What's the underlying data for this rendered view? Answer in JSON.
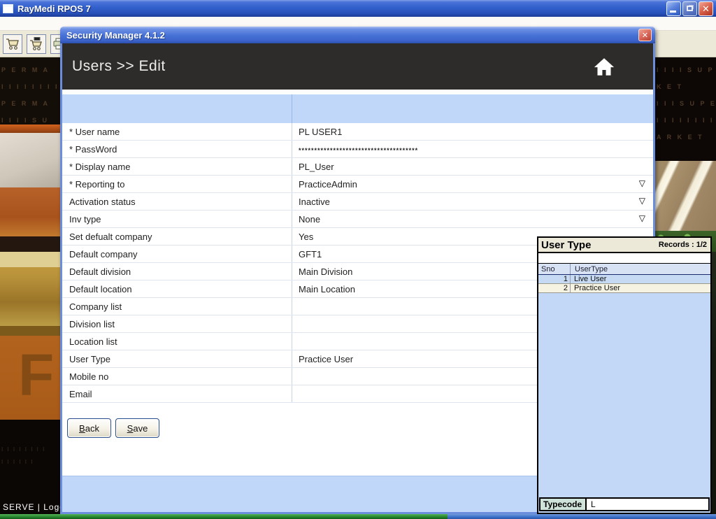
{
  "window": {
    "title": "RayMedi RPOS 7"
  },
  "icons": {
    "dropdown_glyph": "▽",
    "close_glyph": "✕",
    "toolbar": [
      "cart-icon",
      "cart-card-icon",
      "printer-icon"
    ]
  },
  "dialog": {
    "title": "Security Manager 4.1.2",
    "header": "Users >> Edit",
    "form": {
      "rows": [
        {
          "label": "* User name",
          "value": "PL USER1",
          "dropdown": false,
          "masked": false
        },
        {
          "label": "* PassWord",
          "value": "**************************************",
          "dropdown": false,
          "masked": true
        },
        {
          "label": "* Display name",
          "value": "PL_User",
          "dropdown": false,
          "masked": false
        },
        {
          "label": "* Reporting to",
          "value": "PracticeAdmin",
          "dropdown": true,
          "masked": false
        },
        {
          "label": "Activation status",
          "value": "Inactive",
          "dropdown": true,
          "masked": false
        },
        {
          "label": "Inv type",
          "value": "None",
          "dropdown": true,
          "masked": false
        },
        {
          "label": "Set defualt company",
          "value": "Yes",
          "dropdown": false,
          "masked": false
        },
        {
          "label": "Default company",
          "value": "GFT1",
          "dropdown": false,
          "masked": false
        },
        {
          "label": "Default division",
          "value": "Main Division",
          "dropdown": false,
          "masked": false
        },
        {
          "label": "Default location",
          "value": "Main Location",
          "dropdown": false,
          "masked": false
        },
        {
          "label": "Company list",
          "value": "",
          "dropdown": false,
          "masked": false
        },
        {
          "label": "Division list",
          "value": "",
          "dropdown": false,
          "masked": false
        },
        {
          "label": "Location list",
          "value": "",
          "dropdown": false,
          "masked": false
        },
        {
          "label": "User Type",
          "value": "Practice User",
          "dropdown": false,
          "masked": false
        },
        {
          "label": "Mobile no",
          "value": "",
          "dropdown": false,
          "masked": false
        },
        {
          "label": "Email",
          "value": "",
          "dropdown": false,
          "masked": false
        }
      ],
      "buttons": {
        "back": "Back",
        "save": "Save"
      }
    }
  },
  "user_type_panel": {
    "title": "User Type",
    "records": "Records : 1/2",
    "columns": [
      "Sno",
      "UserType"
    ],
    "rows": [
      {
        "sno": "1",
        "type": "Live User",
        "selected": true
      },
      {
        "sno": "2",
        "type": "Practice User",
        "selected": false
      }
    ],
    "typecode_label": "Typecode",
    "typecode_value": "L"
  },
  "status_bar": {
    "text": "SERVE |  Logg"
  },
  "background": {
    "left_sign_rows": [
      "P E R M A",
      "I I I I I I I I I",
      "P E R M A",
      "I I I I S U"
    ],
    "left_dot_rows": [
      "I I  I I I  I I I",
      "I I I I I I"
    ],
    "left_floor_letter": "F",
    "right_sign_rows": [
      "I I I I S U P",
      "K E T",
      "I I I S U P E",
      "I I I I I I I I",
      "A R K E T"
    ],
    "colors": {
      "accent_blue": "#3a62c8",
      "band_blue": "#c1d7f9",
      "cream": "#ece9d8",
      "green_strip": "#1e7a26"
    }
  }
}
